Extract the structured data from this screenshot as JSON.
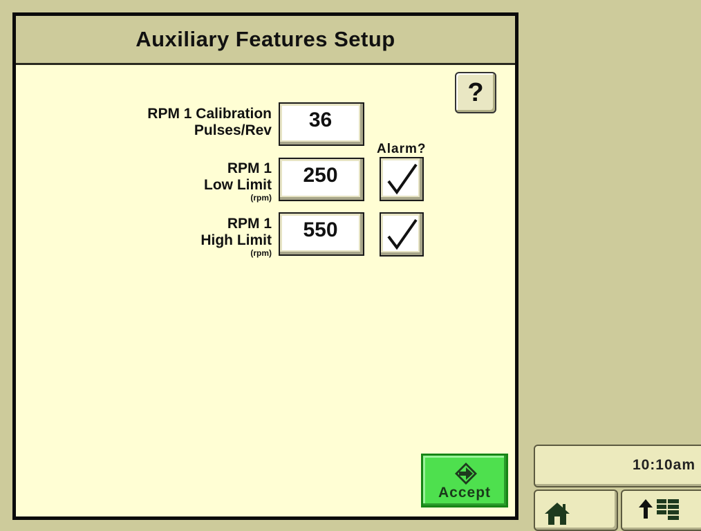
{
  "header": {
    "title": "Auxiliary Features Setup"
  },
  "help": {
    "label": "?"
  },
  "calibration": {
    "label_line1": "RPM 1 Calibration",
    "label_line2": "Pulses/Rev",
    "value": "36"
  },
  "alarm_header": "Alarm?",
  "low_limit": {
    "label_line1": "RPM 1",
    "label_line2": "Low Limit",
    "unit": "(rpm)",
    "value": "250",
    "alarm_checked": true
  },
  "high_limit": {
    "label_line1": "RPM 1",
    "label_line2": "High Limit",
    "unit": "(rpm)",
    "value": "550",
    "alarm_checked": true
  },
  "accept": {
    "label": "Accept"
  },
  "status": {
    "time": "10:10am"
  },
  "icons": {
    "accept": "arrow-in-diamond-icon",
    "home": "home-icon",
    "menu": "up-arrow-menu-icon",
    "check": "checkmark-icon"
  },
  "colors": {
    "panel_bg": "#fffed4",
    "chrome_bg": "#cdcb9b",
    "accept_green": "#4ee04e"
  }
}
